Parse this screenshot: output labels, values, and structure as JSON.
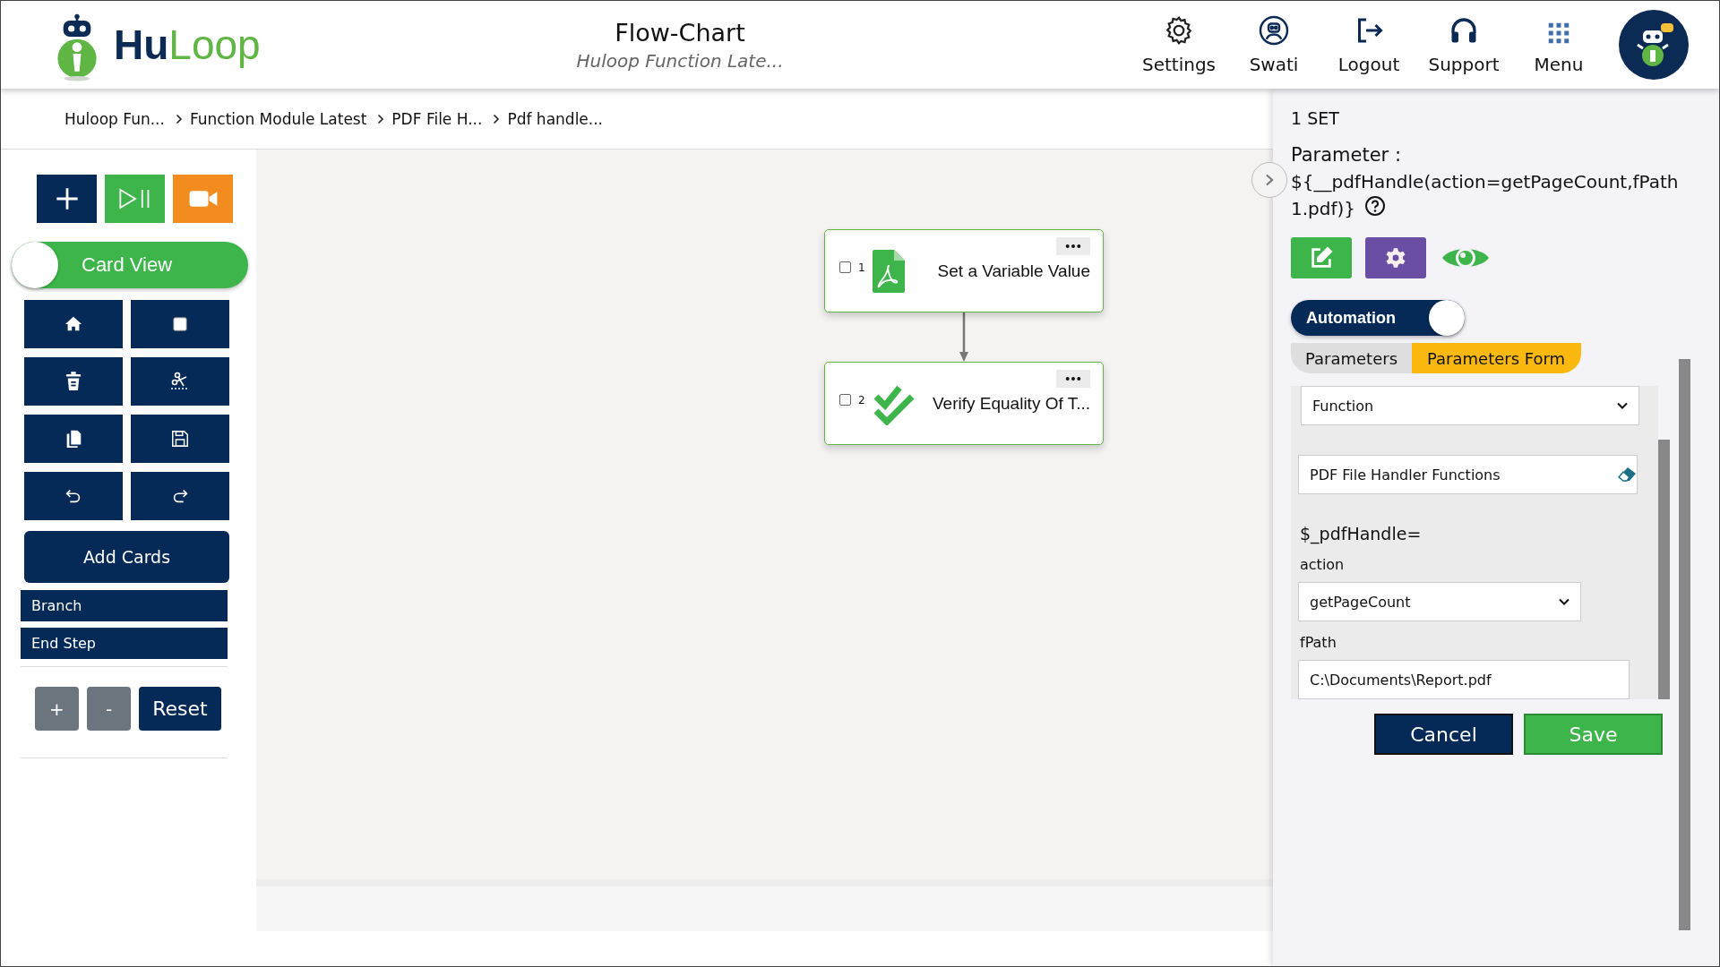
{
  "header": {
    "logo": {
      "part_1": "Hu",
      "part_2": "Loop"
    },
    "title": "Flow-Chart",
    "subtitle": "Huloop Function Late...",
    "nav": [
      {
        "kind": "settings",
        "label": "Settings"
      },
      {
        "kind": "user",
        "label": "Swati"
      },
      {
        "kind": "logout",
        "label": "Logout"
      },
      {
        "kind": "support",
        "label": "Support"
      },
      {
        "kind": "menu",
        "label": "Menu"
      }
    ]
  },
  "breadcrumb": [
    "Huloop Fun...",
    "Function Module Latest",
    "PDF File H...",
    "Pdf handle..."
  ],
  "sidebar": {
    "top_buttons": [
      {
        "kind": "add"
      },
      {
        "kind": "play"
      },
      {
        "kind": "record"
      }
    ],
    "card_view": {
      "label": "Card View",
      "on": false
    },
    "tool_buttons": [
      {
        "kind": "home"
      },
      {
        "kind": "stop"
      },
      {
        "kind": "delete"
      },
      {
        "kind": "cut"
      },
      {
        "kind": "copy"
      },
      {
        "kind": "save"
      },
      {
        "kind": "undo"
      },
      {
        "kind": "redo"
      }
    ],
    "add_cards": "Add Cards",
    "items": [
      "Branch",
      "End Step"
    ],
    "zoom_in": "+",
    "zoom_out": "-",
    "reset": "Reset"
  },
  "flow": {
    "cards": [
      {
        "number": "1",
        "kind": "pdf",
        "title": "Set a Variable Value",
        "checked": false
      },
      {
        "number": "2",
        "kind": "check",
        "title": "Verify Equality Of T...",
        "checked": false
      }
    ]
  },
  "panel": {
    "heading": "1 SET",
    "parameter_label": "Parameter :",
    "parameter_line_1": "${__pdfHandle(action=getPageCount,fPath",
    "parameter_line_2": "1.pdf)}",
    "automation": {
      "label": "Automation",
      "on": true
    },
    "tabs": [
      {
        "label": "Parameters",
        "selected": false
      },
      {
        "label": "Parameters Form",
        "selected": true
      }
    ],
    "form": {
      "function_select": "Function",
      "function_name": "PDF File Handler Functions",
      "signature": "$_pdfHandle=",
      "fields": [
        {
          "kind": "select",
          "label": "action",
          "value": "getPageCount"
        },
        {
          "kind": "text",
          "label": "fPath",
          "value": "C:\\Documents\\Report.pdf"
        }
      ]
    },
    "buttons": [
      {
        "kind": "cancel",
        "label": "Cancel"
      },
      {
        "kind": "save",
        "label": "Save"
      }
    ]
  }
}
